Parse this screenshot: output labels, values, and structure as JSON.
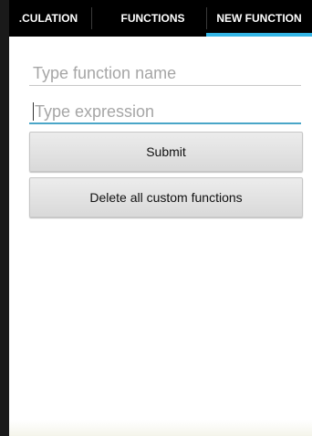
{
  "tabs": [
    {
      "label": ".CULATION",
      "selected": false
    },
    {
      "label": "FUNCTIONS",
      "selected": false
    },
    {
      "label": "NEW FUNCTION",
      "selected": true
    }
  ],
  "form": {
    "name_field": {
      "value": "",
      "placeholder": "Type function name"
    },
    "expression_field": {
      "value": "",
      "placeholder": "Type expression",
      "focused": true
    },
    "submit_label": "Submit",
    "delete_label": "Delete all custom functions"
  },
  "colors": {
    "tab_bar": "#000000",
    "tab_indicator": "#33b5e5",
    "focused_underline": "#4aa6c8",
    "placeholder_text": "#a6a6a6"
  }
}
